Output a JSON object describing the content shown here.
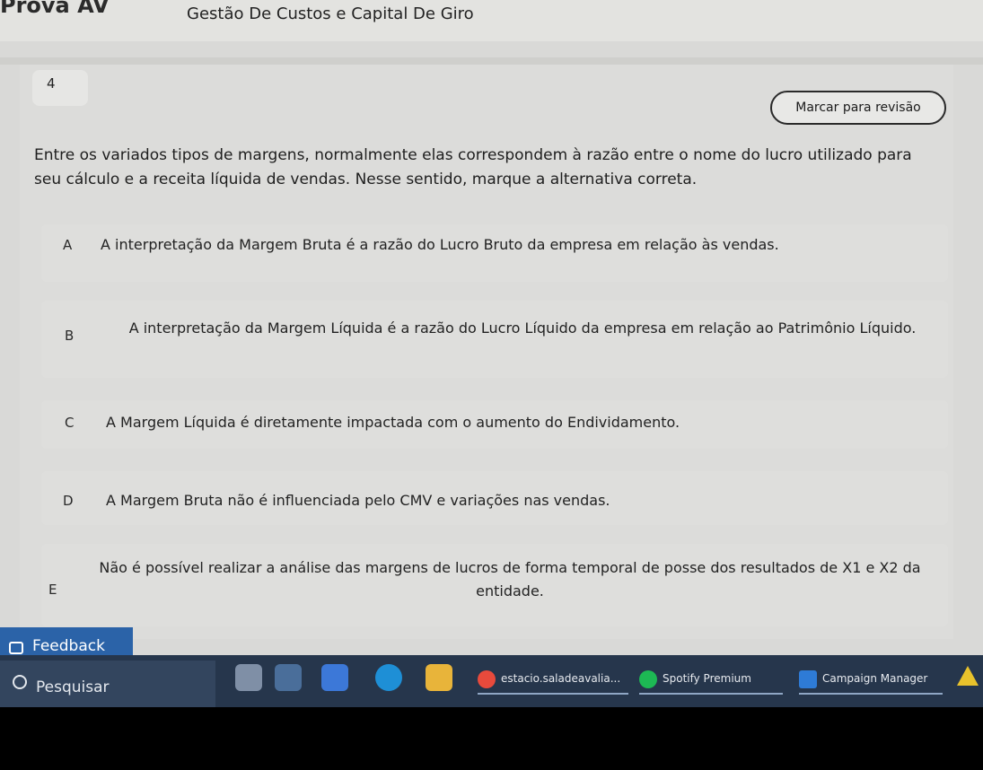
{
  "header": {
    "app_title": "Prova AV",
    "course_title": "Gestão De Custos e Capital De Giro"
  },
  "question": {
    "number": "4",
    "review_label": "Marcar para revisão",
    "text": "Entre os variados tipos de margens, normalmente elas correspondem à razão entre o nome do lucro utilizado para seu cálculo e a receita líquida de vendas. Nesse sentido, marque a alternativa correta."
  },
  "options": [
    {
      "letter": "A",
      "text": "A interpretação da Margem Bruta é a razão do Lucro Bruto da empresa em relação às vendas."
    },
    {
      "letter": "B",
      "text": "A interpretação da Margem Líquida é a razão do Lucro Líquido da empresa em relação ao Patrimônio Líquido."
    },
    {
      "letter": "C",
      "text": "A Margem Líquida é diretamente impactada com o aumento do Endividamento."
    },
    {
      "letter": "D",
      "text": "A Margem Bruta não é influenciada pelo CMV e variações nas vendas."
    },
    {
      "letter": "E",
      "text": "Não é possível realizar a análise das margens de lucros de forma temporal de posse dos resultados de X1 e X2 da entidade."
    }
  ],
  "feedback": {
    "label": "Feedback",
    "icon": "feedback-icon"
  },
  "taskbar": {
    "search_label": "Pesquisar",
    "apps": [
      {
        "label": "estacio.saladeavalia...",
        "icon": "opera-icon",
        "color": "#e84a3c"
      },
      {
        "label": "Spotify Premium",
        "icon": "spotify-icon",
        "color": "#1db954"
      },
      {
        "label": "Campaign Manager",
        "icon": "campaign-manager-icon",
        "color": "#2e7bd6"
      }
    ]
  }
}
